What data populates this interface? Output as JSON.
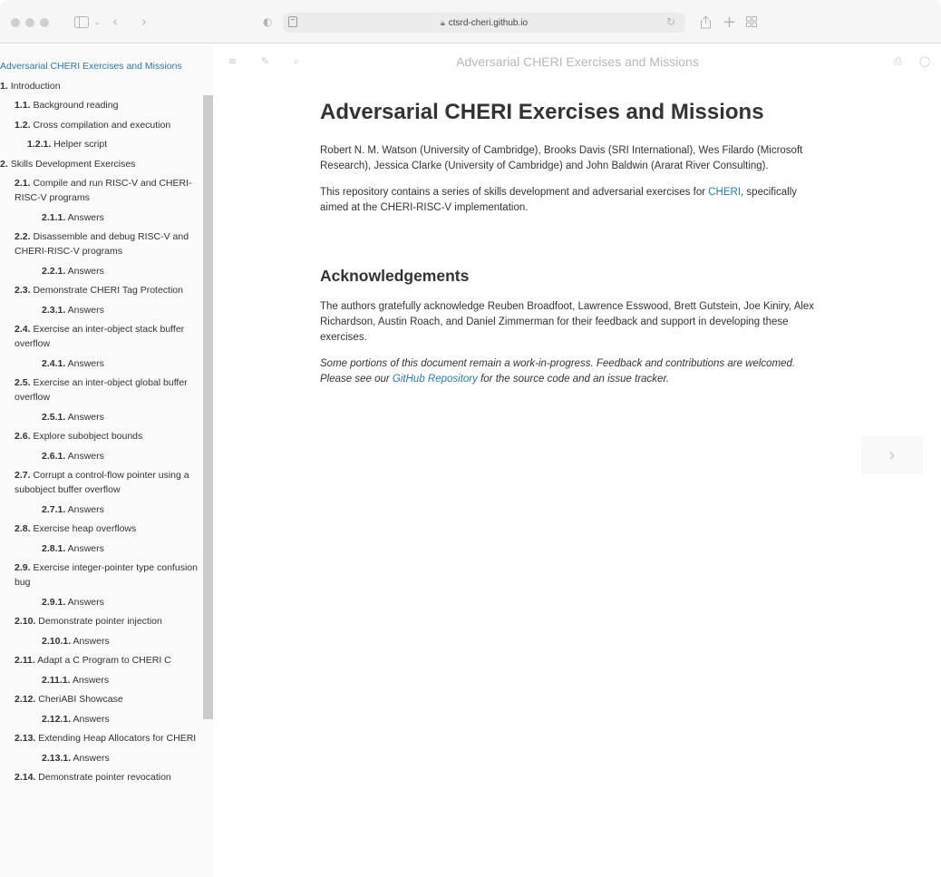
{
  "browser": {
    "url": "ctsrd-cheri.github.io",
    "icons": {
      "sidebar": "sidebar-icon",
      "back": "back-icon",
      "forward": "forward-icon",
      "shield": "privacy-shield-icon",
      "reload": "reload-icon",
      "share": "share-icon",
      "new_tab": "plus-icon",
      "tabs": "tab-overview-icon"
    }
  },
  "topbar": {
    "menu_title": "Adversarial CHERI Exercises and Missions"
  },
  "sidebar": {
    "items": [
      {
        "num": "",
        "label": "Adversarial CHERI Exercises and Missions",
        "level": "active"
      },
      {
        "num": "1.",
        "label": "Introduction",
        "level": "lvl0"
      },
      {
        "num": "1.1.",
        "label": "Background reading",
        "level": "lvl1"
      },
      {
        "num": "1.2.",
        "label": "Cross compilation and execution",
        "level": "lvl1"
      },
      {
        "num": "1.2.1.",
        "label": "Helper script",
        "level": "lvl2"
      },
      {
        "num": "2.",
        "label": "Skills Development Exercises",
        "level": "lvl0"
      },
      {
        "num": "2.1.",
        "label": "Compile and run RISC-V and CHERI-RISC-V programs",
        "level": "lvl1"
      },
      {
        "num": "2.1.1.",
        "label": "Answers",
        "level": "lvl3"
      },
      {
        "num": "2.2.",
        "label": "Disassemble and debug RISC-V and CHERI-RISC-V programs",
        "level": "lvl1"
      },
      {
        "num": "2.2.1.",
        "label": "Answers",
        "level": "lvl3"
      },
      {
        "num": "2.3.",
        "label": "Demonstrate CHERI Tag Protection",
        "level": "lvl1"
      },
      {
        "num": "2.3.1.",
        "label": "Answers",
        "level": "lvl3"
      },
      {
        "num": "2.4.",
        "label": "Exercise an inter-object stack buffer overflow",
        "level": "lvl1"
      },
      {
        "num": "2.4.1.",
        "label": "Answers",
        "level": "lvl3"
      },
      {
        "num": "2.5.",
        "label": "Exercise an inter-object global buffer overflow",
        "level": "lvl1"
      },
      {
        "num": "2.5.1.",
        "label": "Answers",
        "level": "lvl3"
      },
      {
        "num": "2.6.",
        "label": "Explore subobject bounds",
        "level": "lvl1"
      },
      {
        "num": "2.6.1.",
        "label": "Answers",
        "level": "lvl3"
      },
      {
        "num": "2.7.",
        "label": "Corrupt a control-flow pointer using a subobject buffer overflow",
        "level": "lvl1"
      },
      {
        "num": "2.7.1.",
        "label": "Answers",
        "level": "lvl3"
      },
      {
        "num": "2.8.",
        "label": "Exercise heap overflows",
        "level": "lvl1"
      },
      {
        "num": "2.8.1.",
        "label": "Answers",
        "level": "lvl3"
      },
      {
        "num": "2.9.",
        "label": "Exercise integer-pointer type confusion bug",
        "level": "lvl1"
      },
      {
        "num": "2.9.1.",
        "label": "Answers",
        "level": "lvl3"
      },
      {
        "num": "2.10.",
        "label": "Demonstrate pointer injection",
        "level": "lvl1"
      },
      {
        "num": "2.10.1.",
        "label": "Answers",
        "level": "lvl3"
      },
      {
        "num": "2.11.",
        "label": "Adapt a C Program to CHERI C",
        "level": "lvl1"
      },
      {
        "num": "2.11.1.",
        "label": "Answers",
        "level": "lvl3"
      },
      {
        "num": "2.12.",
        "label": "CheriABI Showcase",
        "level": "lvl1"
      },
      {
        "num": "2.12.1.",
        "label": "Answers",
        "level": "lvl3"
      },
      {
        "num": "2.13.",
        "label": "Extending Heap Allocators for CHERI",
        "level": "lvl1"
      },
      {
        "num": "2.13.1.",
        "label": "Answers",
        "level": "lvl3"
      },
      {
        "num": "2.14.",
        "label": "Demonstrate pointer revocation",
        "level": "lvl1"
      }
    ]
  },
  "main": {
    "title": "Adversarial CHERI Exercises and Missions",
    "authors": "Robert N. M. Watson (University of Cambridge), Brooks Davis (SRI International), Wes Filardo (Microsoft Research), Jessica Clarke (University of Cambridge) and John Baldwin (Ararat River Consulting).",
    "intro_before": "This repository contains a series of skills development and adversarial exercises for ",
    "intro_link": "CHERI",
    "intro_after": ", specifically aimed at the CHERI-RISC-V implementation.",
    "ack_heading": "Acknowledgements",
    "ack_text": "The authors gratefully acknowledge Reuben Broadfoot, Lawrence Esswood, Brett Gutstein, Joe Kiniry, Alex Richardson, Austin Roach, and Daniel Zimmerman for their feedback and support in developing these exercises.",
    "note_before": "Some portions of this document remain a work-in-progress. Feedback and contributions are welcomed. Please see our ",
    "note_link": "GitHub Repository",
    "note_after": " for the source code and an issue tracker."
  },
  "nav": {
    "next_glyph": "›"
  }
}
